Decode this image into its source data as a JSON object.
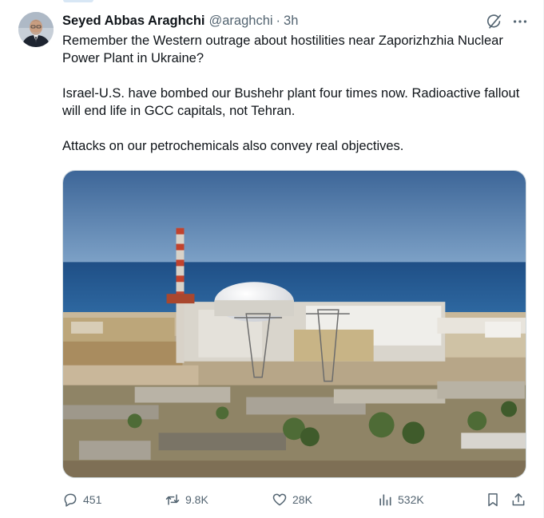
{
  "tweet": {
    "author_name": "Seyed Abbas Araghchi",
    "handle": "@araghchi",
    "separator": "·",
    "time": "3h",
    "paragraphs": [
      "Remember the Western outrage about hostilities near Zaporizhzhia Nuclear Power Plant in Ukraine?",
      "Israel-U.S. have bombed our Bushehr plant four times now. Radioactive fallout will end life in GCC capitals, not Tehran.",
      "Attacks on our petrochemicals also convey real objectives."
    ],
    "media_description_icon": "nuclear-plant-photo"
  },
  "actions": {
    "replies": "451",
    "reposts": "9.8K",
    "likes": "28K",
    "views": "532K"
  },
  "colors": {
    "text": "#0f1419",
    "secondary": "#536471",
    "border": "#eff3f4"
  }
}
